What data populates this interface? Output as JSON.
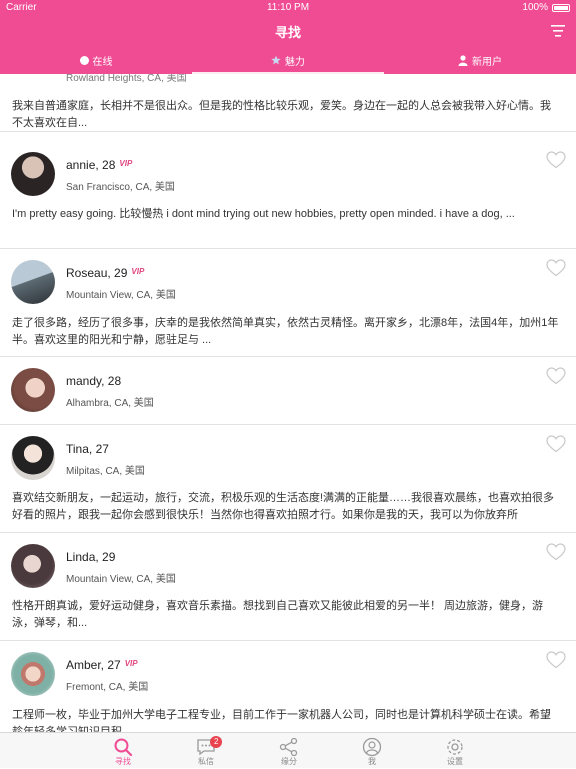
{
  "status_bar": {
    "carrier": "Carrier",
    "time": "11:10 PM",
    "battery": "100%"
  },
  "nav": {
    "title": "寻找"
  },
  "tabs": [
    {
      "label": "在线",
      "icon": "dot-icon"
    },
    {
      "label": "魅力",
      "icon": "star-icon"
    },
    {
      "label": "新用户",
      "icon": "person-icon"
    }
  ],
  "profiles": [
    {
      "name": "",
      "vip": "",
      "location": "Rowland Heights, CA, 美国",
      "bio": "我来自普通家庭，长相并不是很出众。但是我的性格比较乐观，爱笑。身边在一起的人总会被我带入好心情。我不太喜欢在自..."
    },
    {
      "name": "annie, 28",
      "vip": "VIP",
      "location": "San Francisco, CA, 美国",
      "bio": "I'm pretty easy going. 比较慢热 i dont mind trying out new hobbies, pretty open minded. i have a dog, ..."
    },
    {
      "name": "Roseau, 29",
      "vip": "VIP",
      "location": "Mountain View, CA, 美国",
      "bio": "走了很多路，经历了很多事，庆幸的是我依然简单真实，依然古灵精怪。离开家乡，北漂8年，法国4年，加州1年半。喜欢这里的阳光和宁静，愿驻足与 ..."
    },
    {
      "name": "mandy, 28",
      "vip": "",
      "location": "Alhambra, CA, 美国",
      "bio": ""
    },
    {
      "name": "Tina, 27",
      "vip": "",
      "location": "Milpitas, CA, 美国",
      "bio": "喜欢结交新朋友，一起运动，旅行，交流，积极乐观的生活态度!满满的正能量……我很喜欢晨练，也喜欢拍很多好看的照片，跟我一起你会感到很快乐！当然你也得喜欢拍照才行。如果你是我的天，我可以为你放弃所"
    },
    {
      "name": "Linda, 29",
      "vip": "",
      "location": "Mountain View, CA, 美国",
      "bio": "性格开朗真诚，爱好运动健身，喜欢音乐素描。想找到自己喜欢又能彼此相爱的另一半！ 周边旅游，健身，游泳，弹琴，和..."
    },
    {
      "name": "Amber, 27",
      "vip": "VIP",
      "location": "Fremont, CA, 美国",
      "bio": "工程师一枚，毕业于加州大学电子工程专业，目前工作于一家机器人公司，同时也是计算机科学硕士在读。希望趁年轻多学习知识目积..."
    }
  ],
  "tabbar": [
    {
      "label": "寻找",
      "icon": "search-icon",
      "active": true
    },
    {
      "label": "私信",
      "icon": "message-icon",
      "badge": "2"
    },
    {
      "label": "缘分",
      "icon": "share-icon"
    },
    {
      "label": "我",
      "icon": "profile-icon"
    },
    {
      "label": "设置",
      "icon": "gear-icon"
    }
  ],
  "colors": {
    "accent": "#ef4c94",
    "vip": "#e0457f",
    "badge": "#e8434f"
  }
}
